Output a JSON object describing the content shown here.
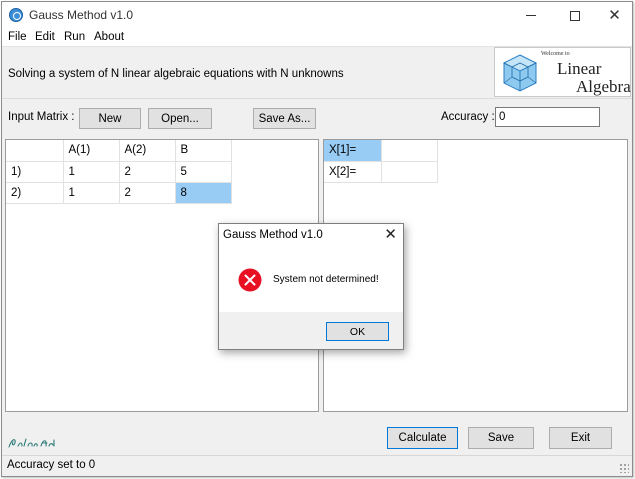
{
  "window": {
    "title": "Gauss Method v1.0"
  },
  "menu": [
    "File",
    "Edit",
    "Run",
    "About"
  ],
  "header": {
    "subtitle": "Solving a system of N linear algebraic equations with N unknowns",
    "logo": {
      "welcome": "Welcome to",
      "line1": "Linear",
      "line2": "Algebra"
    }
  },
  "toolbar": {
    "input_label": "Input Matrix :",
    "new_label": "New",
    "open_label": "Open...",
    "saveas_label": "Save As...",
    "accuracy_label": "Accuracy :",
    "accuracy_value": "0"
  },
  "matrix": {
    "headers": [
      "",
      "A(1)",
      "A(2)",
      "B"
    ],
    "rows": [
      [
        "1)",
        "1",
        "2",
        "5"
      ],
      [
        "2)",
        "1",
        "2",
        "8"
      ]
    ]
  },
  "results": {
    "rows": [
      [
        "X[1]=",
        ""
      ],
      [
        "X[2]=",
        ""
      ]
    ]
  },
  "footer": {
    "signature": "Pálma Art",
    "calculate_label": "Calculate",
    "save_label": "Save",
    "exit_label": "Exit"
  },
  "status": {
    "text": "Accuracy set to 0"
  },
  "dialog": {
    "title": "Gauss Method v1.0",
    "message": "System not determined!",
    "ok_label": "OK"
  },
  "colors": {
    "selection": "#99ccf5",
    "accent": "#0078d7",
    "error": "#e81123"
  }
}
